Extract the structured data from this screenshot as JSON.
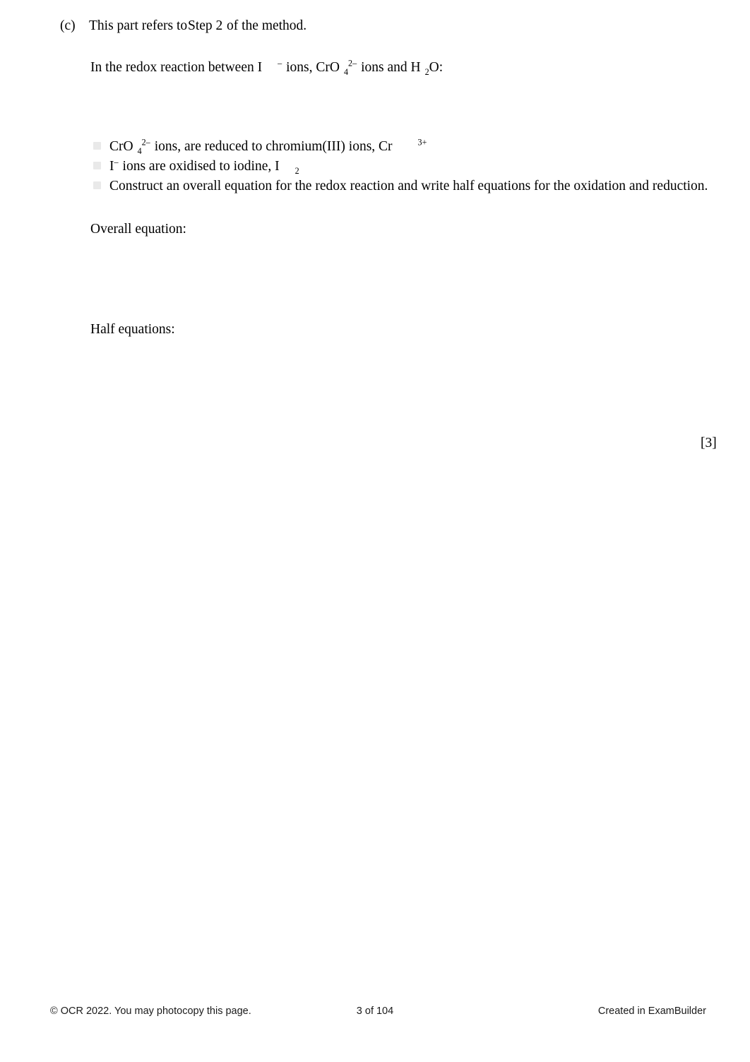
{
  "question": {
    "part_label": "(c)",
    "part_text": "This part refers to",
    "step_reference": "Step 2",
    "part_tail": "of the method.",
    "intro": {
      "lead": "In the redox reaction between I",
      "iodide_charge": "–",
      "mid1": "ions, CrO",
      "chromate_sub": "4",
      "chromate_charge": "2–",
      "mid2": "ions and H",
      "water_sub": "2",
      "tail": "O:"
    },
    "bullets": [
      {
        "id": "bullet-chromate-reduction",
        "marker": "square-bullet",
        "lead": "CrO",
        "sub": "4",
        "sup": "2–",
        "mid": "ions, are reduced to chromium(III) ions, Cr",
        "trailing_sup": "3+"
      },
      {
        "id": "bullet-iodide-oxidation",
        "marker": "square-bullet",
        "lead": "I",
        "sup": "–",
        "mid": "ions are oxidised to iodine, I",
        "trailing_sub": "2"
      },
      {
        "id": "bullet-construct-instruction",
        "marker": "square-bullet",
        "text": "Construct an overall equation for the redox reaction and write half equations for the oxidation and reduction."
      }
    ],
    "prompts": {
      "overall_equation": "Overall equation:",
      "half_equations": "Half equations:"
    },
    "marks": "[3]"
  },
  "footer": {
    "copyright": "© OCR 2022. You may photocopy this page.",
    "page_number": "3 of 104",
    "created_by": "Created in ExamBuilder"
  },
  "colors": {
    "page_background": "#ffffff",
    "text": "#000000",
    "bullet_marker": "#e9e9e9",
    "footer_text": "#1a1a1a"
  }
}
